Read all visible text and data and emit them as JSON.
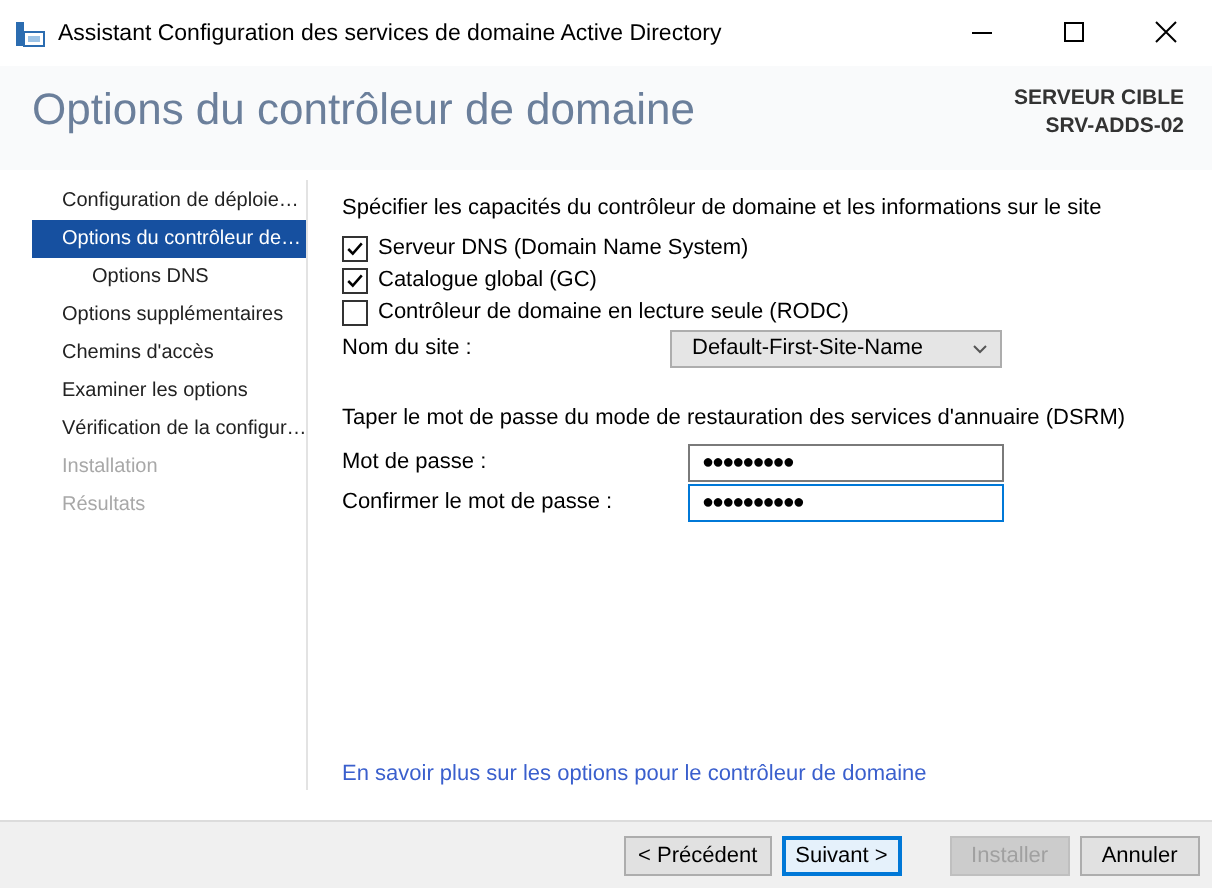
{
  "window": {
    "title": "Assistant Configuration des services de domaine Active Directory"
  },
  "header": {
    "title": "Options du contrôleur de domaine",
    "target_label": "SERVEUR CIBLE",
    "target_name": "SRV-ADDS-02"
  },
  "sidebar": {
    "items": [
      {
        "label": "Configuration de déploie…",
        "selected": false,
        "disabled": false
      },
      {
        "label": "Options du contrôleur de…",
        "selected": true,
        "disabled": false,
        "children": [
          {
            "label": "Options DNS",
            "selected": false,
            "disabled": false
          }
        ]
      },
      {
        "label": "Options supplémentaires",
        "selected": false,
        "disabled": false
      },
      {
        "label": "Chemins d'accès",
        "selected": false,
        "disabled": false
      },
      {
        "label": "Examiner les options",
        "selected": false,
        "disabled": false
      },
      {
        "label": "Vérification de la configur…",
        "selected": false,
        "disabled": false
      },
      {
        "label": "Installation",
        "selected": false,
        "disabled": true
      },
      {
        "label": "Résultats",
        "selected": false,
        "disabled": true
      }
    ]
  },
  "capabilities": {
    "heading": "Spécifier les capacités du contrôleur de domaine et les informations sur le site",
    "options": [
      {
        "label": "Serveur DNS (Domain Name System)",
        "checked": true
      },
      {
        "label": "Catalogue global (GC)",
        "checked": true
      },
      {
        "label": "Contrôleur de domaine en lecture seule (RODC)",
        "checked": false
      }
    ],
    "site": {
      "label": "Nom du site :",
      "value": "Default-First-Site-Name"
    }
  },
  "dsrm": {
    "heading": "Taper le mot de passe du mode de restauration des services d'annuaire (DSRM)",
    "fields": [
      {
        "label": "Mot de passe :",
        "value": "●●●●●●●●●",
        "focused": false
      },
      {
        "label": "Confirmer le mot de passe :",
        "value": "●●●●●●●●●●",
        "focused": true
      }
    ]
  },
  "link": "En savoir plus sur les options pour le contrôleur de domaine",
  "buttons": [
    {
      "label": "< Précédent",
      "default": false,
      "disabled": false
    },
    {
      "label": "Suivant >",
      "default": true,
      "disabled": false
    },
    {
      "label": "Installer",
      "default": false,
      "disabled": true
    },
    {
      "label": "Annuler",
      "default": false,
      "disabled": false
    }
  ]
}
